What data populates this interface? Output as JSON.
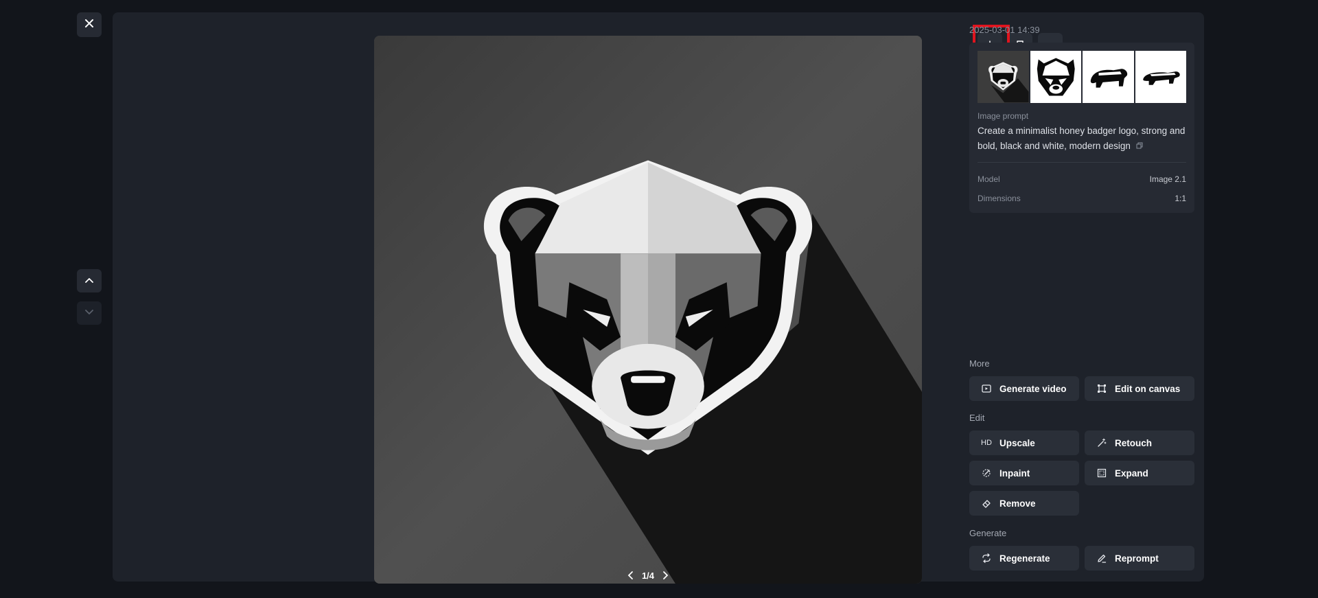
{
  "viewer": {
    "close_icon": "close-icon",
    "nav_up_icon": "chevron-up-icon",
    "nav_down_icon": "chevron-down-icon",
    "pager": {
      "label": "1/4"
    },
    "toolbar": {
      "download_icon": "download-icon",
      "bookmark_icon": "bookmark-icon",
      "more_icon": "more-horizontal-icon",
      "highlight_color": "#e0141e"
    }
  },
  "details": {
    "timestamp": "2025-03-01 14:39",
    "prompt_label": "Image prompt",
    "prompt_text": "Create a minimalist honey badger logo, strong and bold, black and white, modern design",
    "model_label": "Model",
    "model_value": "Image 2.1",
    "dimensions_label": "Dimensions",
    "dimensions_value": "1:1"
  },
  "actions": {
    "more_label": "More",
    "generate_video": "Generate video",
    "edit_on_canvas": "Edit on canvas",
    "edit_label": "Edit",
    "upscale_badge": "HD",
    "upscale": "Upscale",
    "retouch": "Retouch",
    "inpaint": "Inpaint",
    "expand": "Expand",
    "remove": "Remove",
    "generate_label": "Generate",
    "regenerate": "Regenerate",
    "reprompt": "Reprompt"
  },
  "colors": {
    "background": "#12151b",
    "panel": "#1e222a",
    "button": "#2a2f38",
    "text_muted": "#8b919c"
  }
}
